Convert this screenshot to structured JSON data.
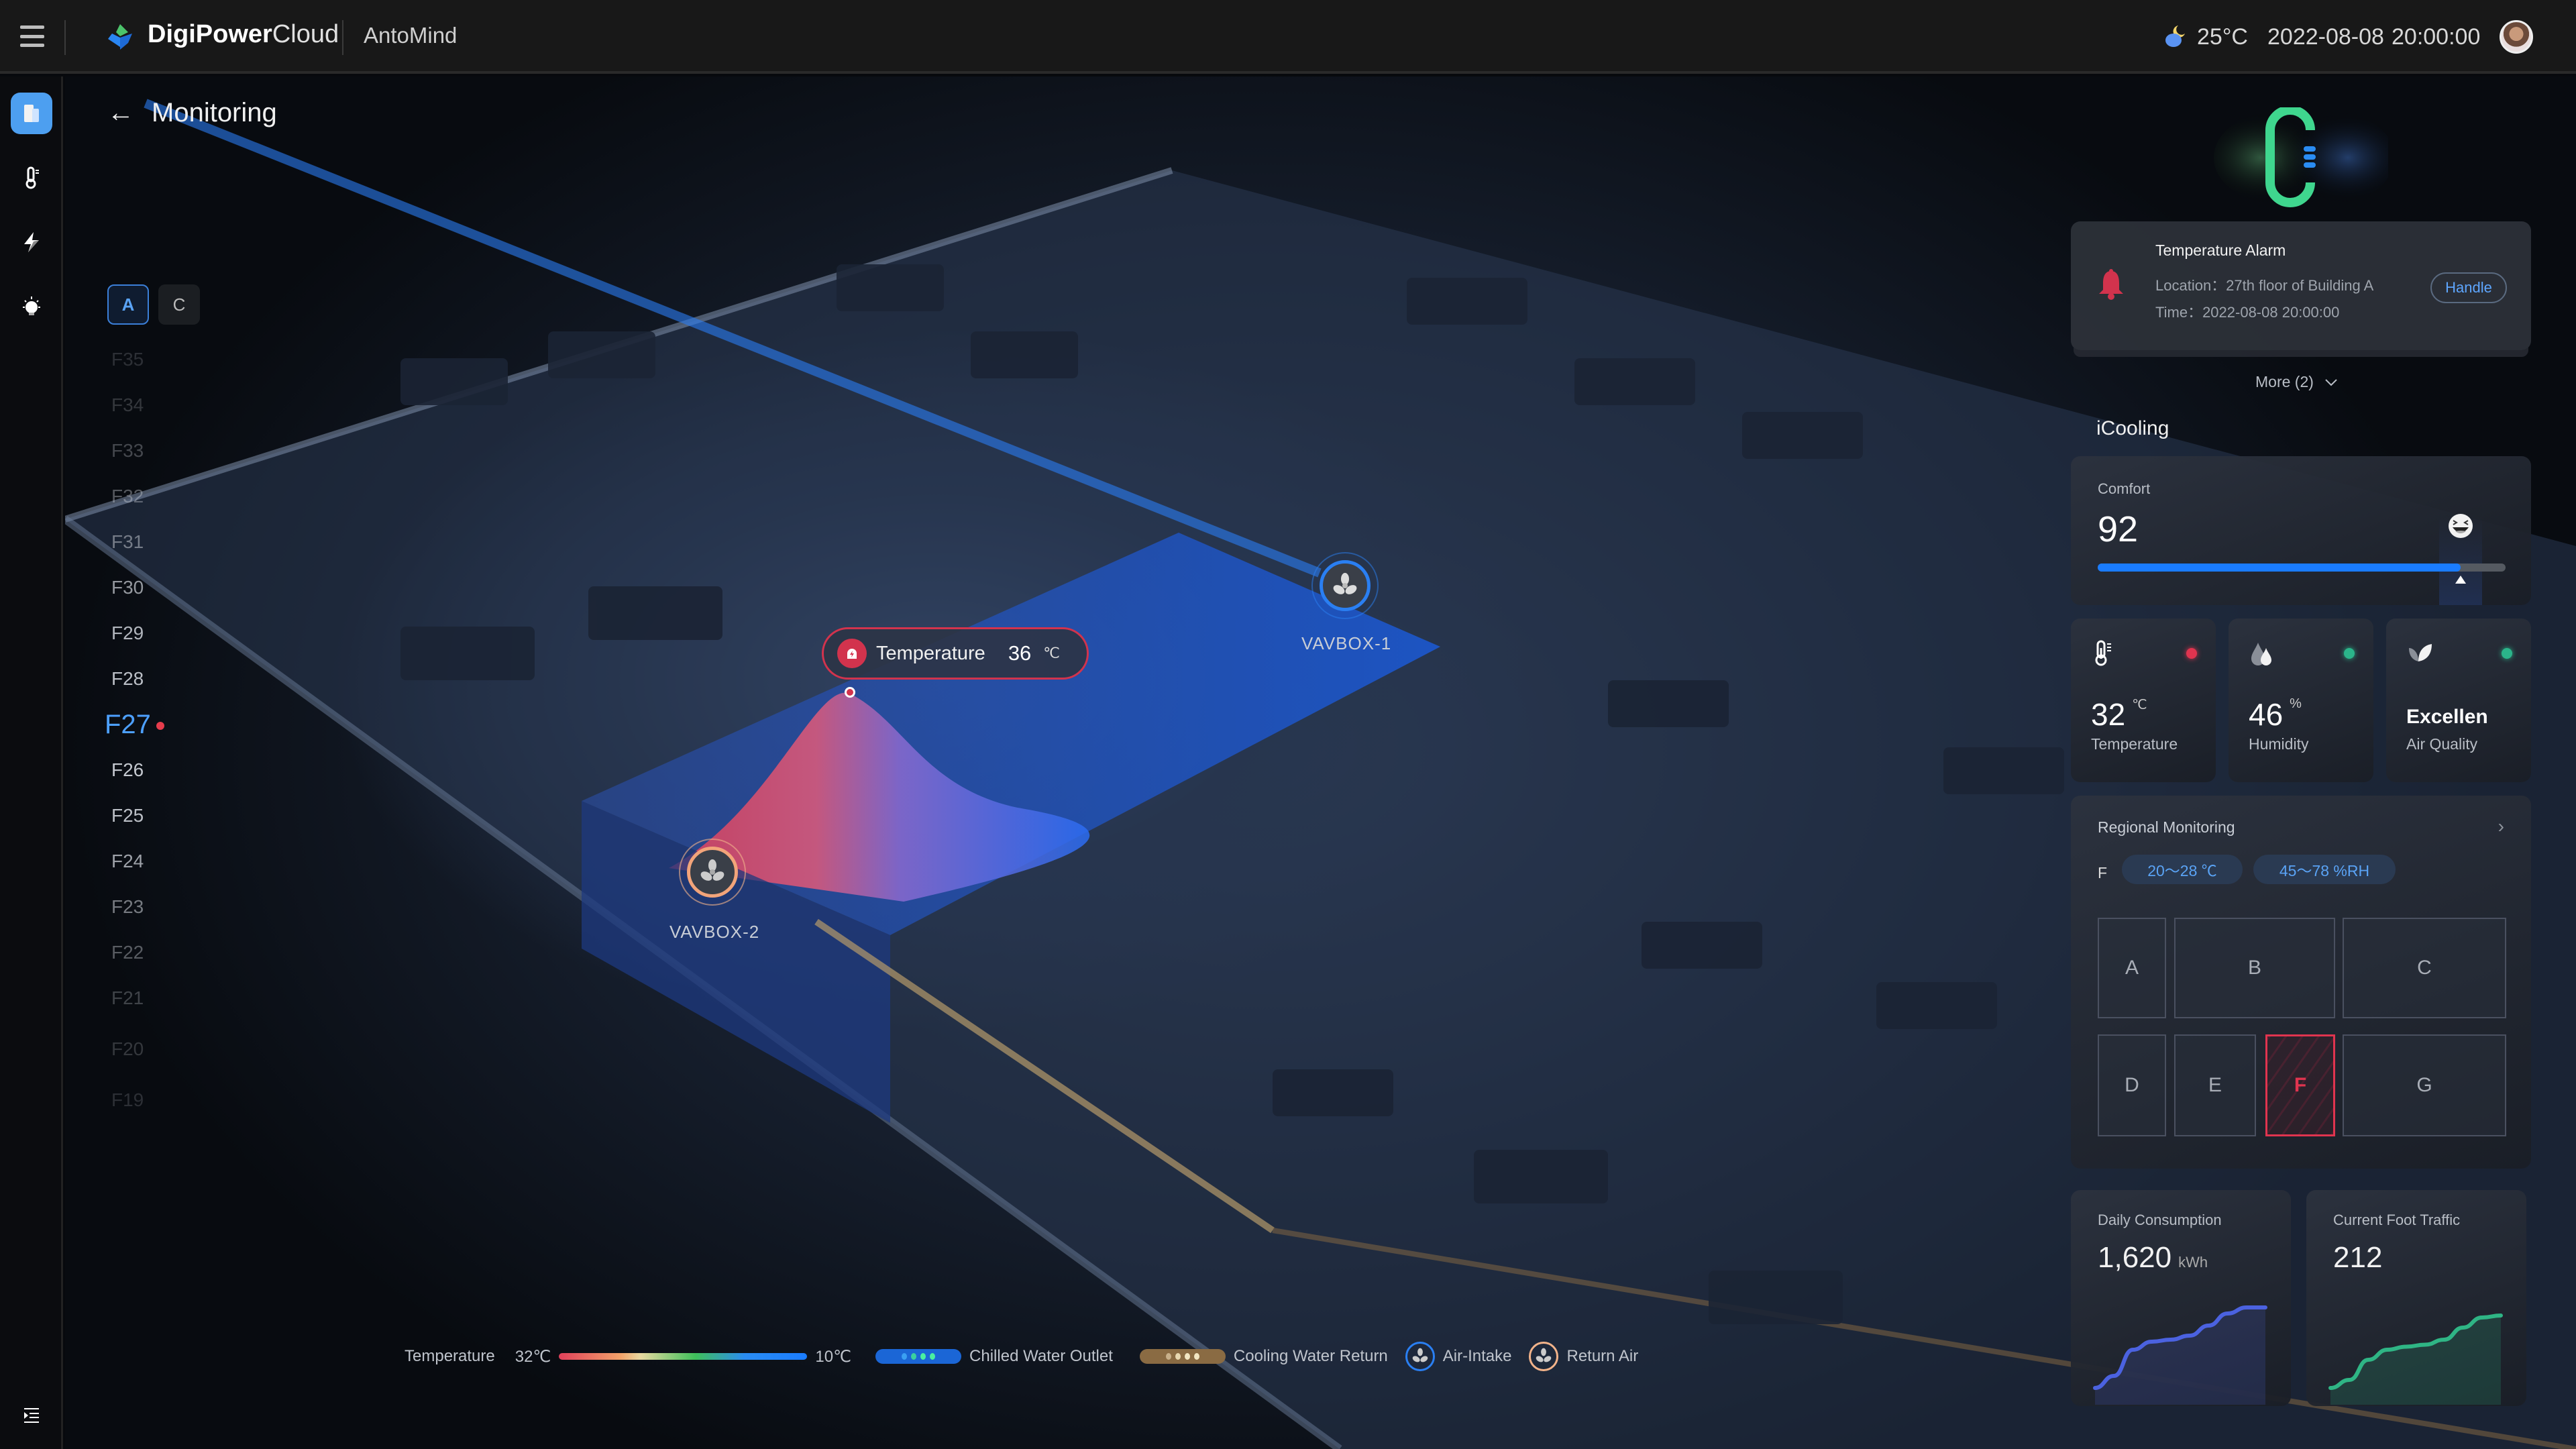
{
  "header": {
    "menu_icon": "hamburger-icon",
    "brand_bold": "DigiPower",
    "brand_light": "Cloud",
    "product": "AntoMind",
    "weather_icon": "moon-cloud-icon",
    "temperature": "25°C",
    "date": "2022-08-08",
    "time": "20:00:00",
    "avatar_icon": "user-avatar"
  },
  "rail": {
    "items": [
      {
        "icon": "building-icon",
        "active": true
      },
      {
        "icon": "thermometer-icon",
        "active": false
      },
      {
        "icon": "lightning-icon",
        "active": false
      },
      {
        "icon": "lightbulb-icon",
        "active": false
      }
    ],
    "bottom_icon": "expand-menu-icon"
  },
  "page": {
    "title": "Monitoring",
    "back_icon": "arrow-left-icon"
  },
  "buildings": {
    "tabs": [
      "A",
      "C"
    ],
    "active": "A"
  },
  "floors": {
    "items": [
      "F35",
      "F34",
      "F33",
      "F32",
      "F31",
      "F30",
      "F29",
      "F28",
      "F27",
      "F26",
      "F25",
      "F24",
      "F23",
      "F22",
      "F21",
      "F20",
      "F19"
    ],
    "active": "F27",
    "alert_floor": "F27"
  },
  "scene": {
    "temperature_tag": {
      "label": "Temperature",
      "value": "36",
      "unit": "℃",
      "icon": "alarm-siren-icon"
    },
    "vavboxes": [
      {
        "label": "VAVBOX-1",
        "type": "air-intake"
      },
      {
        "label": "VAVBOX-2",
        "type": "return-air"
      }
    ]
  },
  "legend": {
    "temperature_label": "Temperature",
    "temp_high": "32℃",
    "temp_low": "10℃",
    "chilled": "Chilled Water Outlet",
    "cooling": "Cooling Water Return",
    "intake": "Air-Intake",
    "return": "Return Air"
  },
  "alarm": {
    "title": "Temperature Alarm",
    "location": "Location：27th floor of Building A",
    "time": "Time：2022-08-08  20:00:00",
    "handle_label": "Handle",
    "more_label": "More (2)"
  },
  "icooling": {
    "title": "iCooling",
    "comfort": {
      "label": "Comfort",
      "value": "92",
      "percent": 89
    },
    "metrics": [
      {
        "value": "32",
        "unit": "℃",
        "label": "Temperature",
        "status": "alert",
        "icon": "thermometer-icon"
      },
      {
        "value": "46",
        "unit": "%",
        "label": "Humidity",
        "status": "ok",
        "icon": "water-drops-icon"
      },
      {
        "value": "Excellen",
        "unit": "",
        "label": "Air Quality",
        "status": "ok",
        "icon": "leaves-icon"
      }
    ],
    "status_colors": {
      "alert": "#e0344f",
      "ok": "#2bb58a"
    }
  },
  "regional": {
    "title": "Regional Monitoring",
    "selected_zone": "F",
    "temp_range": "20～28 ℃",
    "humidity_range": "45～78 %RH",
    "zones": [
      "A",
      "B",
      "C",
      "D",
      "E",
      "F",
      "G"
    ]
  },
  "stats": {
    "consumption": {
      "label": "Daily Consumption",
      "value": "1,620",
      "unit": "kWh",
      "color": "#4b62e0",
      "trend": [
        10,
        22,
        48,
        56,
        58,
        62,
        72,
        84,
        90,
        90
      ]
    },
    "traffic": {
      "label": "Current Foot Traffic",
      "value": "212",
      "color": "#2fb585",
      "trend": [
        10,
        18,
        38,
        48,
        51,
        53,
        58,
        70,
        80,
        82
      ]
    }
  }
}
